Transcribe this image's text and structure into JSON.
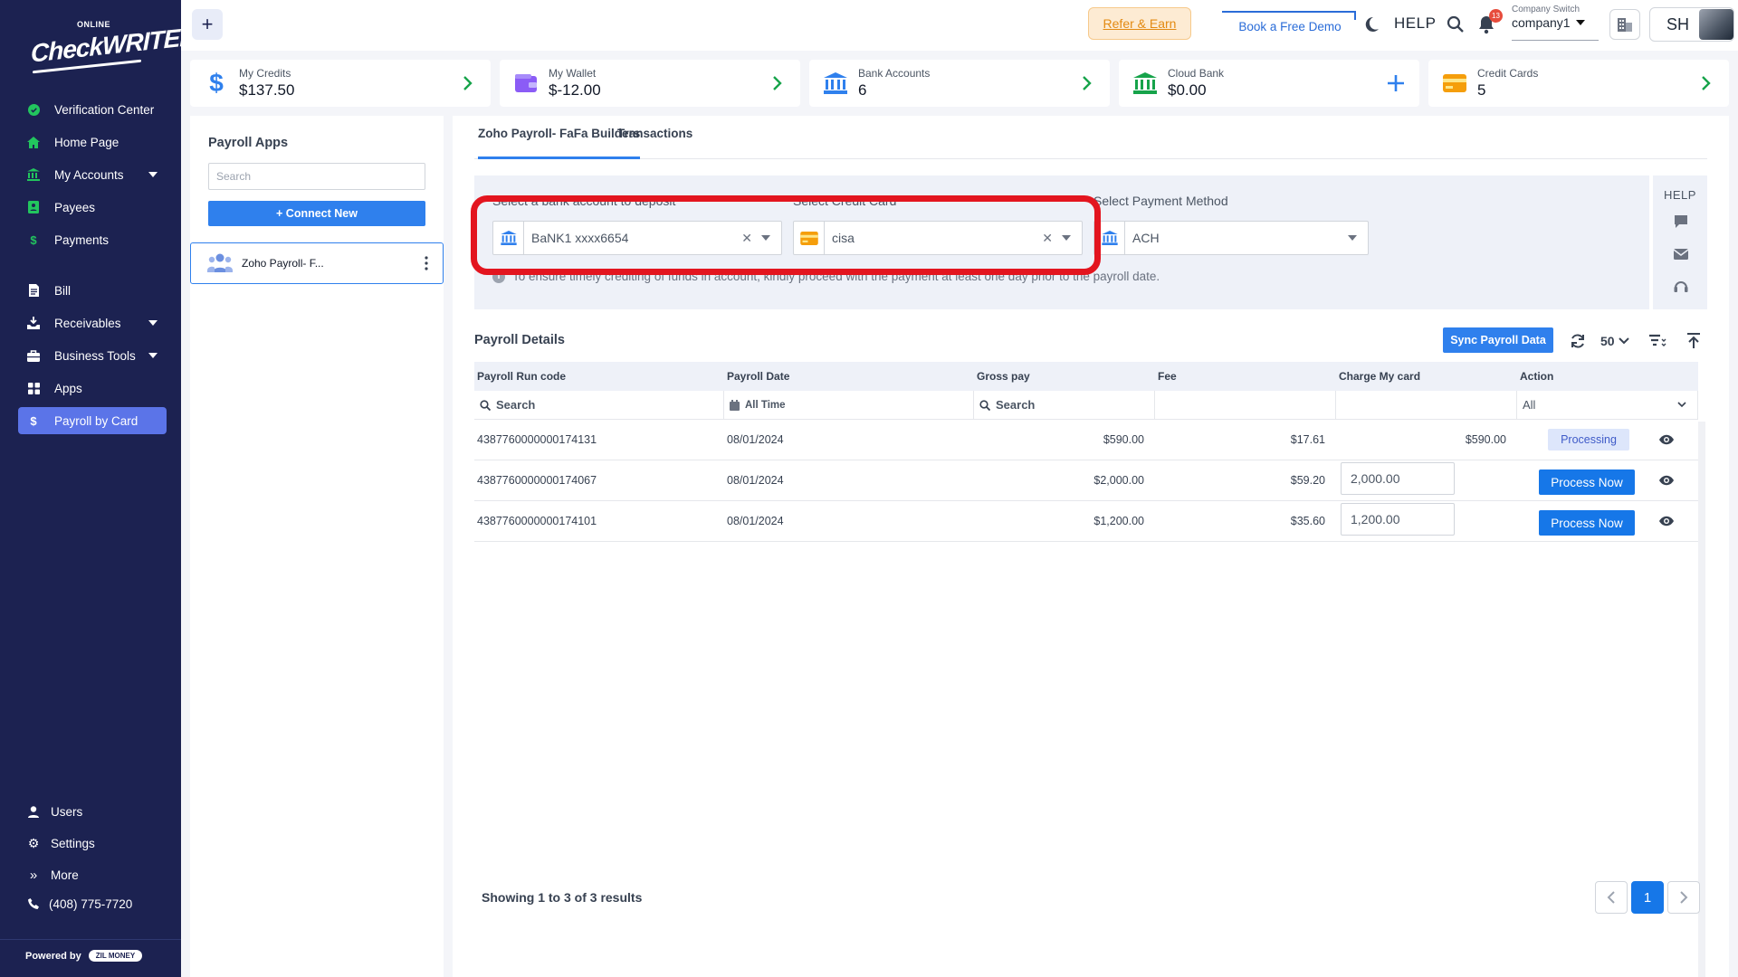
{
  "brand": {
    "top": "ONLINE",
    "name": "CheckWRITER"
  },
  "sidebar": {
    "items": [
      {
        "label": "Verification Center",
        "icon": "check-circle-icon"
      },
      {
        "label": "Home Page",
        "icon": "home-icon"
      },
      {
        "label": "My Accounts",
        "icon": "bank-icon"
      },
      {
        "label": "Payees",
        "icon": "contact-book-icon"
      },
      {
        "label": "Payments",
        "icon": "dollar-icon"
      },
      {
        "label": "Bill",
        "icon": "bill-icon"
      },
      {
        "label": "Receivables",
        "icon": "receivables-icon"
      },
      {
        "label": "Business Tools",
        "icon": "briefcase-icon"
      },
      {
        "label": "Apps",
        "icon": "apps-grid-icon"
      },
      {
        "label": "Payroll by Card",
        "icon": "dollar-icon"
      }
    ],
    "bottom": [
      {
        "label": "Users",
        "icon": "user-icon"
      },
      {
        "label": "Settings",
        "icon": "gear-icon"
      },
      {
        "label": "More",
        "icon": "double-chevron-icon"
      },
      {
        "label": "(408) 775-7720",
        "icon": "phone-icon"
      }
    ],
    "powered_by": "Powered by",
    "zil": "ZIL MONEY"
  },
  "topbar": {
    "refer": "Refer & Earn",
    "demo": "Book a Free Demo",
    "help": "HELP",
    "notifications": "13",
    "company_label": "Company Switch",
    "company_value": "company1",
    "initials": "SH"
  },
  "cards": [
    {
      "label": "My Credits",
      "value": "$137.50",
      "color": "#2f80ed"
    },
    {
      "label": "My Wallet",
      "value": "$-12.00",
      "color": "#8b5cf6"
    },
    {
      "label": "Bank Accounts",
      "value": "6",
      "color": "#2f80ed"
    },
    {
      "label": "Cloud Bank",
      "value": "$0.00",
      "color": "#16a34a"
    },
    {
      "label": "Credit Cards",
      "value": "5",
      "color": "#f59e0b"
    }
  ],
  "left": {
    "title": "Payroll Apps",
    "search_placeholder": "Search",
    "connect": "+ Connect New",
    "app_name": "Zoho Payroll- F..."
  },
  "main": {
    "tabs": [
      "Zoho Payroll- FaFa Builders",
      "Transactions"
    ],
    "bank_label": "Select a bank account to deposit",
    "bank_value": "BaNK1 xxxx6654",
    "card_label": "Select Credit Card",
    "card_value": "cisa",
    "method_label": "Select Payment Method",
    "method_value": "ACH",
    "info": "To ensure timely crediting of funds in account, kindly proceed with the payment at least one day prior to the payroll date.",
    "help": "HELP",
    "details_title": "Payroll Details",
    "sync": "Sync Payroll Data",
    "per_page": "50",
    "columns": [
      "Payroll Run code",
      "Payroll Date",
      "Gross pay",
      "Fee",
      "Charge My card",
      "Action"
    ],
    "filters": {
      "search": "Search",
      "date": "All Time",
      "search2": "Search",
      "action": "All"
    },
    "rows": [
      {
        "code": "4387760000000174131",
        "date": "08/01/2024",
        "gross": "$590.00",
        "fee": "$17.61",
        "charge": "$590.00",
        "status": "Processing"
      },
      {
        "code": "4387760000000174067",
        "date": "08/01/2024",
        "gross": "$2,000.00",
        "fee": "$59.20",
        "charge": "2,000.00",
        "action": "Process Now"
      },
      {
        "code": "4387760000000174101",
        "date": "08/01/2024",
        "gross": "$1,200.00",
        "fee": "$35.60",
        "charge": "1,200.00",
        "action": "Process Now"
      }
    ],
    "showing": "Showing 1 to 3 of 3 results",
    "page": "1"
  }
}
